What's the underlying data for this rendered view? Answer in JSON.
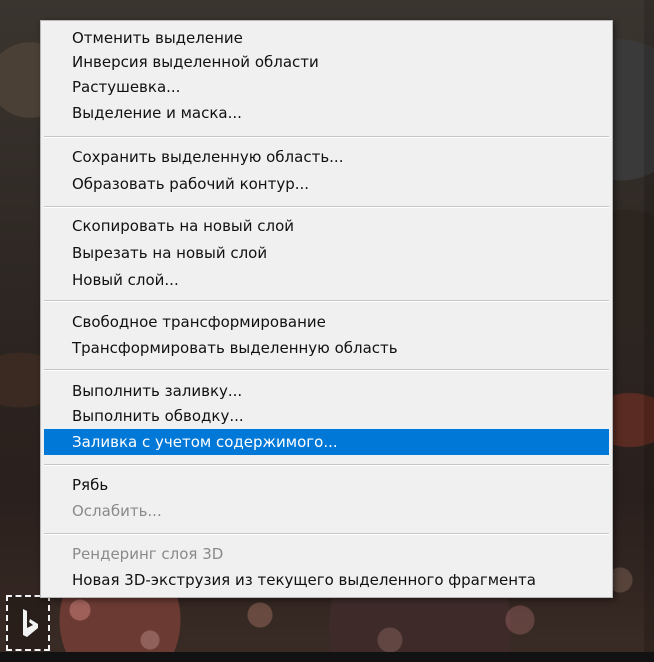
{
  "menu": {
    "items": [
      {
        "label": "Отменить выделение",
        "disabled": false
      },
      {
        "label": "Инверсия выделенной области",
        "disabled": false
      },
      {
        "label": "Растушевка...",
        "disabled": false
      },
      {
        "label": "Выделение и маска...",
        "disabled": false
      },
      {
        "label": "Сохранить выделенную область...",
        "disabled": false
      },
      {
        "label": "Образовать рабочий контур...",
        "disabled": false
      },
      {
        "label": "Скопировать на новый слой",
        "disabled": false
      },
      {
        "label": "Вырезать на новый слой",
        "disabled": false
      },
      {
        "label": "Новый слой...",
        "disabled": false
      },
      {
        "label": "Свободное трансформирование",
        "disabled": false
      },
      {
        "label": "Трансформировать выделенную область",
        "disabled": false
      },
      {
        "label": "Выполнить заливку...",
        "disabled": false
      },
      {
        "label": "Выполнить обводку...",
        "disabled": false
      },
      {
        "label": "Заливка с учетом содержимого...",
        "disabled": false,
        "active": true
      },
      {
        "label": "Рябь",
        "disabled": false
      },
      {
        "label": "Ослабить...",
        "disabled": true
      },
      {
        "label": "Рендеринг слоя 3D",
        "disabled": true
      },
      {
        "label": "Новая 3D-экструзия из текущего выделенного фрагмента",
        "disabled": false
      }
    ]
  },
  "colors": {
    "menu_background": "#f0f0f0",
    "highlight": "#0078d7",
    "disabled_text": "#8a8a8a"
  },
  "icons": {
    "corner": "selection-icon"
  }
}
